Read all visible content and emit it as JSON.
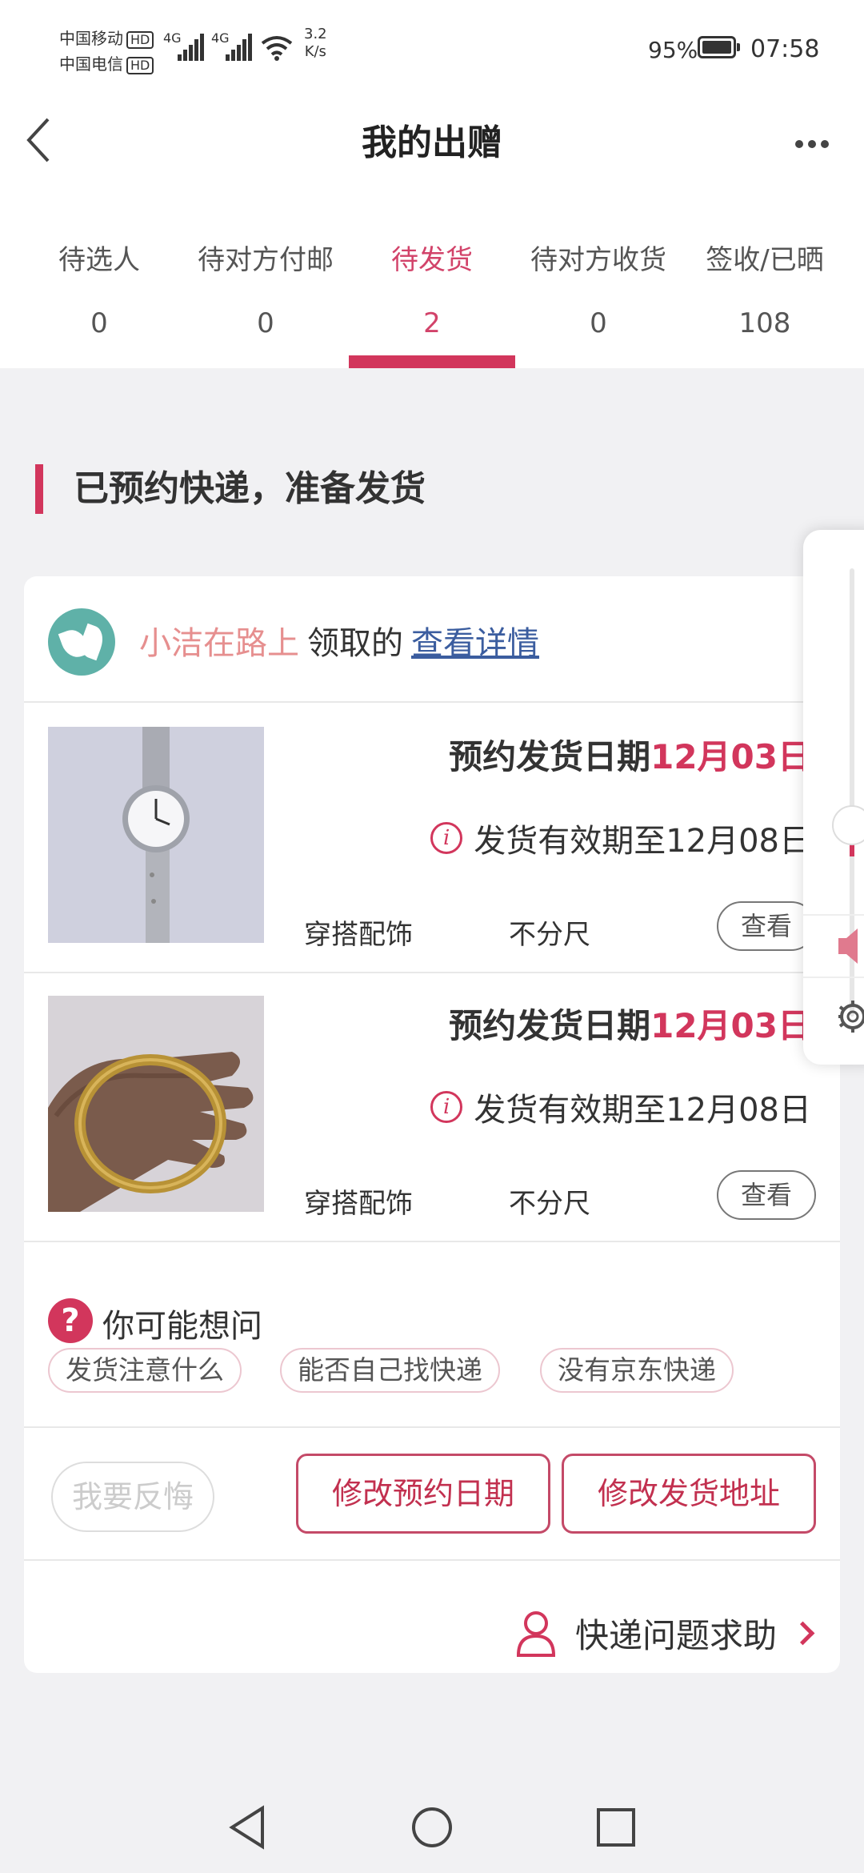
{
  "status_bar": {
    "carrier1": "中国移动",
    "carrier2": "中国电信",
    "hd": "HD",
    "net1": "4G",
    "net2": "4G",
    "speed_value": "3.2",
    "speed_unit": "K/s",
    "battery": "95%",
    "time": "07:58"
  },
  "header": {
    "title": "我的出赠",
    "back_icon": "chevron-left-icon",
    "more_icon": "more-dots-icon"
  },
  "tabs": [
    {
      "label": "待选人",
      "count": "0"
    },
    {
      "label": "待对方付邮",
      "count": "0"
    },
    {
      "label": "待发货",
      "count": "2",
      "active": true
    },
    {
      "label": "待对方收货",
      "count": "0"
    },
    {
      "label": "签收/已晒",
      "count": "108"
    }
  ],
  "section": {
    "title": "已预约快递，准备发货"
  },
  "giver": {
    "name": "小洁在路上",
    "action": "领取的",
    "link": "查看详情"
  },
  "items": [
    {
      "pickup_label": "预约发货日期",
      "pickup_date": "12月03日",
      "expiry": "发货有效期至12月08日",
      "category": "穿搭配饰",
      "size": "不分尺",
      "view": "查看",
      "image": "wristwatch-photo"
    },
    {
      "pickup_label": "预约发货日期",
      "pickup_date": "12月03日",
      "expiry": "发货有效期至12月08日",
      "category": "穿搭配饰",
      "size": "不分尺",
      "view": "查看",
      "image": "gold-bangle-photo"
    }
  ],
  "faq": {
    "title": "你可能想问",
    "chips": [
      "发货注意什么",
      "能否自己找快递",
      "没有京东快递"
    ]
  },
  "actions": {
    "regret": "我要反悔",
    "change_date": "修改预约日期",
    "change_address": "修改发货地址"
  },
  "help": {
    "label": "快递问题求助"
  },
  "colors": {
    "accent": "#d2365c",
    "link": "#3b5d9f",
    "name": "#e68f8f",
    "background": "#f1f1f3"
  }
}
